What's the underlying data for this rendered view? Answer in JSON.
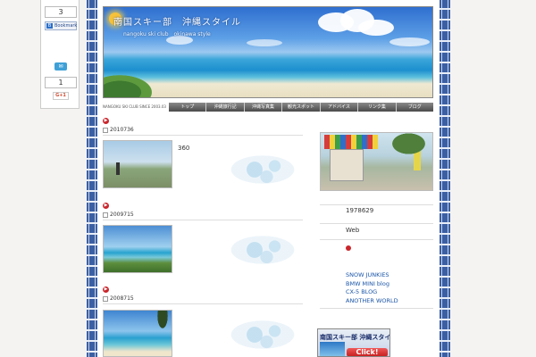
{
  "share": {
    "hatena_count": "3",
    "hatena_label": "Bookmark",
    "hatena_b": "B",
    "tweet_icon": "twitter-bird-icon",
    "gplus_count": "1",
    "gplus_label": "G+1"
  },
  "header": {
    "title": "南国スキー部　沖縄スタイル",
    "tagline": "nangoku ski club　okinawa style"
  },
  "nav": {
    "label": "NANGOKU SKI CLUB SINCE 2003.03",
    "items": [
      "トップ",
      "沖縄旅行記",
      "沖縄写真集",
      "観光スポット",
      "アドバイス",
      "リンク集",
      "ブログ"
    ]
  },
  "posts": [
    {
      "date": "2010736",
      "text": "360"
    },
    {
      "date": "2009715",
      "text": ""
    },
    {
      "date": "2008715",
      "text": ""
    }
  ],
  "sidebar": {
    "number": "1978629",
    "web_label": "Web",
    "links": [
      "SNOW JUNKIES",
      "BMW MINI blog",
      "CX-5 BLOG",
      "ANOTHER WORLD"
    ],
    "banner_title": "南国スキー部 沖縄スタイル",
    "banner_button": "Click!"
  },
  "colors": {
    "accent_red": "#c9262c",
    "link_blue": "#1a55a8",
    "border_blue": "#3b5fa3"
  }
}
